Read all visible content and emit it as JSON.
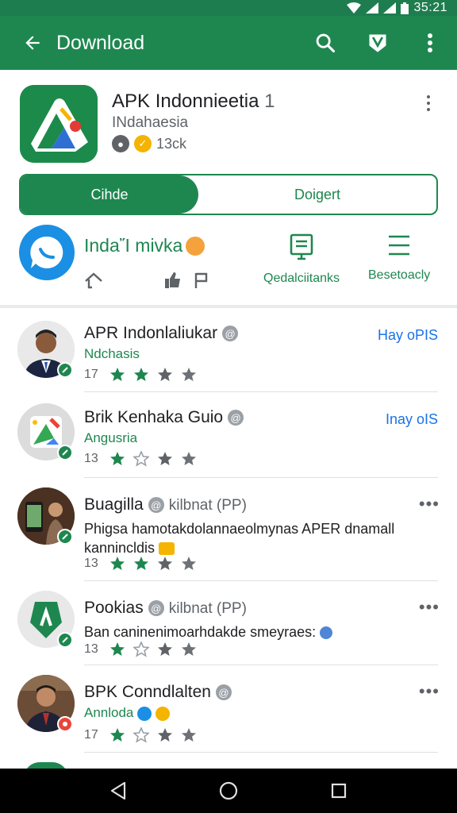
{
  "status_bar": {
    "time": "35:21"
  },
  "app_bar": {
    "title": "Download",
    "back_icon": "arrow-back-icon",
    "actions": [
      "search-icon",
      "shield-icon",
      "more-vert-icon"
    ]
  },
  "app": {
    "name": "APK Indonnieetia",
    "name_suffix": "1",
    "publisher": "INdahaesia",
    "meta_text": "13ck"
  },
  "segment": {
    "active": "Cihde",
    "inactive": "Doigert"
  },
  "feature": {
    "title": "IndaἼ mivka",
    "actions": [
      {
        "label": "Qedalciitanks",
        "icon": "document-icon"
      },
      {
        "label": "Besetoacly",
        "icon": "menu-icon"
      }
    ]
  },
  "items": [
    {
      "title": "APR Indonlaliukar",
      "subtitle": "Ndchasis",
      "count": "17",
      "link": "Hay oPIS",
      "accent": "#1e874f"
    },
    {
      "title": "Brik Kenhaka Guio",
      "subtitle": "Angusria",
      "count": "13",
      "link": "Inay oIS",
      "accent": "#1e874f"
    },
    {
      "title": "Buagilla",
      "tag": "kilbnat (PP)",
      "description": "Phigsa hamotakdolannaeolmynas APER dnamall kannincldis",
      "count": "13",
      "more": "•••",
      "accent": "#1e874f"
    },
    {
      "title": "Pookias",
      "tag": "kilbnat (PP)",
      "description": "Ban caninenimoarhdakde smeyraes:",
      "count": "13",
      "more": "•••",
      "accent": "#1e874f"
    },
    {
      "title": "BPK Conndlalten",
      "subtitle": "Annloda",
      "count": "17",
      "more": "•••",
      "accent": "#e8453c"
    }
  ],
  "colors": {
    "primary": "#1e874f",
    "link": "#1a73e8"
  }
}
